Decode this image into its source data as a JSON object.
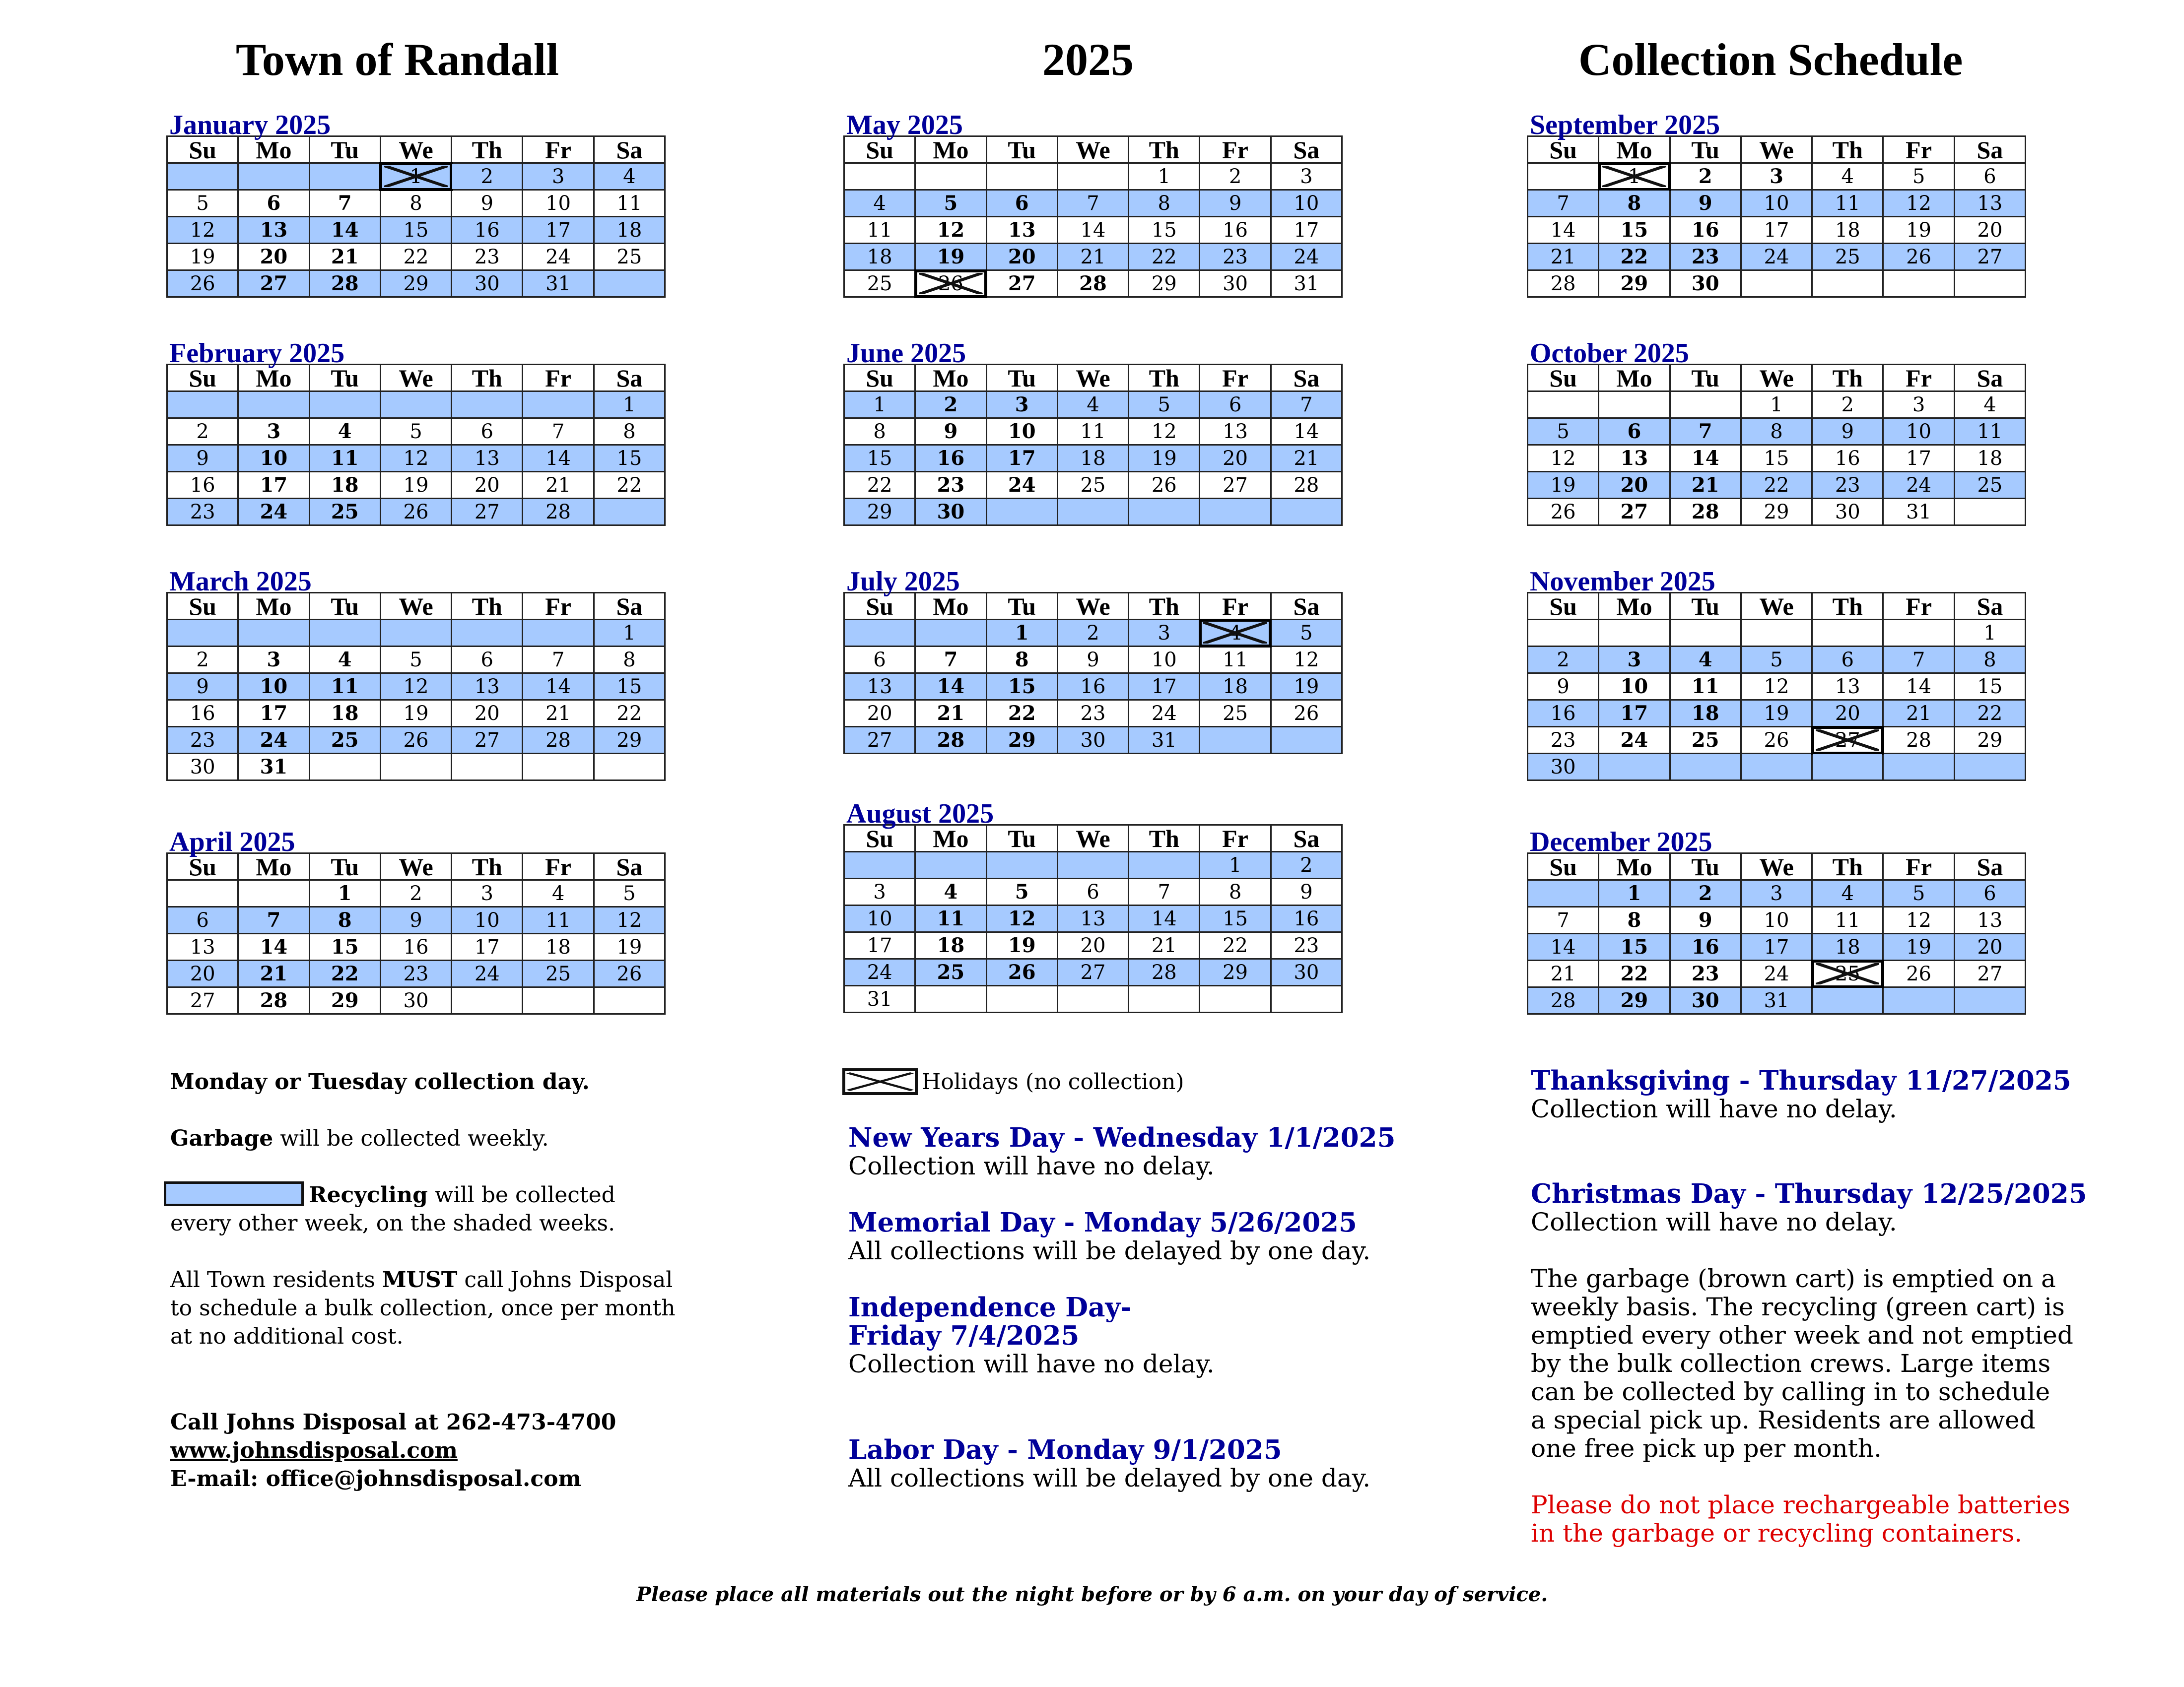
{
  "header": {
    "left": "Town of Randall",
    "center": "2025",
    "right": "Collection Schedule"
  },
  "colors": {
    "recycling_shade": "#A6CAFF",
    "title_blue": "#000099",
    "warning_red": "#DD0000"
  },
  "weekdays": [
    "Su",
    "Mo",
    "Tu",
    "We",
    "Th",
    "Fr",
    "Sa"
  ],
  "months": [
    {
      "title": "January 2025",
      "first_weekday": 3,
      "days": 31,
      "shaded_weeks": [
        0,
        2,
        4
      ],
      "bold": [
        6,
        7,
        13,
        14,
        20,
        21,
        27,
        28
      ],
      "holidays": [
        1
      ]
    },
    {
      "title": "February 2025",
      "first_weekday": 6,
      "days": 28,
      "shaded_weeks": [
        0,
        2,
        4
      ],
      "bold": [
        3,
        4,
        10,
        11,
        17,
        18,
        24,
        25
      ],
      "holidays": []
    },
    {
      "title": "March 2025",
      "first_weekday": 6,
      "days": 31,
      "shaded_weeks": [
        0,
        2,
        4
      ],
      "bold": [
        3,
        4,
        10,
        11,
        17,
        18,
        24,
        25,
        31
      ],
      "holidays": []
    },
    {
      "title": "April 2025",
      "first_weekday": 2,
      "days": 30,
      "shaded_weeks": [
        1,
        3
      ],
      "bold": [
        1,
        7,
        8,
        14,
        15,
        21,
        22,
        28,
        29
      ],
      "holidays": []
    },
    {
      "title": "May 2025",
      "first_weekday": 4,
      "days": 31,
      "shaded_weeks": [
        1,
        3
      ],
      "bold": [
        5,
        6,
        12,
        13,
        19,
        20,
        27,
        28
      ],
      "holidays": [
        26
      ]
    },
    {
      "title": "June 2025",
      "first_weekday": 0,
      "days": 30,
      "shaded_weeks": [
        0,
        2,
        4
      ],
      "bold": [
        2,
        3,
        9,
        10,
        16,
        17,
        23,
        24,
        30
      ],
      "holidays": []
    },
    {
      "title": "July 2025",
      "first_weekday": 2,
      "days": 31,
      "shaded_weeks": [
        0,
        2,
        4
      ],
      "bold": [
        1,
        7,
        8,
        14,
        15,
        21,
        22,
        28,
        29
      ],
      "holidays": [
        4
      ]
    },
    {
      "title": "August 2025",
      "first_weekday": 5,
      "days": 31,
      "shaded_weeks": [
        0,
        2,
        4
      ],
      "bold": [
        4,
        5,
        11,
        12,
        18,
        19,
        25,
        26
      ],
      "holidays": []
    },
    {
      "title": "September 2025",
      "first_weekday": 1,
      "days": 30,
      "shaded_weeks": [
        1,
        3
      ],
      "bold": [
        2,
        3,
        8,
        9,
        15,
        16,
        22,
        23,
        29,
        30
      ],
      "holidays": [
        1
      ]
    },
    {
      "title": "October 2025",
      "first_weekday": 3,
      "days": 31,
      "shaded_weeks": [
        1,
        3
      ],
      "bold": [
        6,
        7,
        13,
        14,
        20,
        21,
        27,
        28
      ],
      "holidays": []
    },
    {
      "title": "November 2025",
      "first_weekday": 6,
      "days": 30,
      "shaded_weeks": [
        1,
        3,
        5
      ],
      "bold": [
        3,
        4,
        10,
        11,
        17,
        18,
        24,
        25
      ],
      "holidays": [
        27
      ]
    },
    {
      "title": "December 2025",
      "first_weekday": 1,
      "days": 31,
      "shaded_weeks": [
        0,
        2,
        4
      ],
      "bold": [
        1,
        2,
        8,
        9,
        15,
        16,
        22,
        23,
        29,
        30
      ],
      "holidays": [
        25
      ]
    }
  ],
  "left_info": {
    "collection_day": "Monday or Tuesday collection day.",
    "garbage_bold": "Garbage",
    "garbage_rest": " will be collected weekly.",
    "recycling_bold": "Recycling",
    "recycling_rest": " will be collected",
    "recycling_line2": "every other week, on the shaded weeks.",
    "bulk_line1_a": "All Town residents ",
    "bulk_line1_bold": "MUST",
    "bulk_line1_b": " call Johns Disposal",
    "bulk_line2": "to schedule a bulk collection, once per month",
    "bulk_line3": "at no additional cost.",
    "call_line": "Call Johns Disposal at 262-473-4700",
    "website": "www.johnsdisposal.com",
    "email": "E-mail: office@johnsdisposal.com"
  },
  "legend": {
    "holiday_label": "Holidays (no collection)"
  },
  "holidays_info": [
    {
      "title": "New Years Day - Wednesday 1/1/2025",
      "desc": "Collection will have no delay."
    },
    {
      "title": "Memorial Day - Monday 5/26/2025",
      "desc": "All collections will be delayed by one day."
    },
    {
      "title_line1": "Independence Day-",
      "title_line2": "Friday 7/4/2025",
      "desc": "Collection will have no delay."
    },
    {
      "title": "Labor Day - Monday 9/1/2025",
      "desc": "All collections will be delayed by one day."
    },
    {
      "title": "Thanksgiving - Thursday 11/27/2025",
      "desc": "Collection will have no delay."
    },
    {
      "title": "Christmas Day - Thursday 12/25/2025",
      "desc": "Collection will have no delay."
    }
  ],
  "right_info": {
    "paragraph": [
      "The garbage (brown cart) is emptied on a",
      "weekly basis. The recycling (green cart) is",
      "emptied every other week and not emptied",
      "by the bulk collection crews. Large items",
      "can be collected by calling in to schedule",
      "a special pick up. Residents are allowed",
      "one free pick up per month."
    ],
    "warning": [
      "Please do not place rechargeable batteries",
      "in the garbage or recycling containers."
    ]
  },
  "footer": "Please place all materials out the night before or by 6 a.m. on your day of service."
}
